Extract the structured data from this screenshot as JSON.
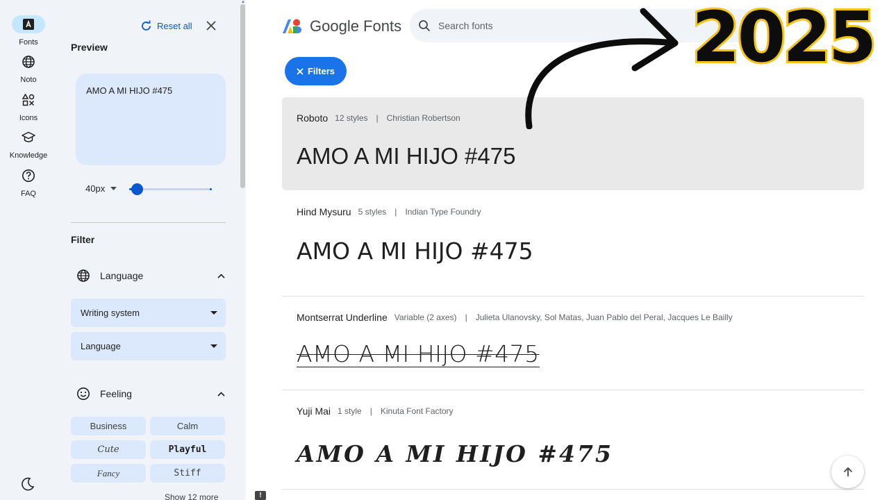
{
  "rail": {
    "items": [
      {
        "label": "Fonts",
        "icon": "font-icon",
        "active": true
      },
      {
        "label": "Noto",
        "icon": "globe-icon"
      },
      {
        "label": "Icons",
        "icon": "shapes-icon"
      },
      {
        "label": "Knowledge",
        "icon": "school-icon"
      },
      {
        "label": "FAQ",
        "icon": "help-icon"
      }
    ],
    "dark_mode_icon": "moon-icon"
  },
  "panel": {
    "reset_label": "Reset all",
    "preview_title": "Preview",
    "preview_text": "AMO A MI HIJO #475",
    "size_value": "40px",
    "size_fraction": 0.1,
    "filter_title": "Filter",
    "language_section": "Language",
    "writing_system_label": "Writing system",
    "language_dropdown_label": "Language",
    "feeling_section": "Feeling",
    "feeling_chips": [
      "Business",
      "Calm",
      "Cute",
      "Playful",
      "Fancy",
      "Stiff"
    ],
    "show_more": "Show 12 more"
  },
  "header": {
    "logo_text": "Google Fonts",
    "search_placeholder": "Search fonts",
    "filters_button": "Filters"
  },
  "fonts": [
    {
      "name": "Roboto",
      "styles": "12 styles",
      "designer": "Christian Robertson",
      "sample": "AMO A MI HIJO #475"
    },
    {
      "name": "Hind Mysuru",
      "styles": "5 styles",
      "designer": "Indian Type Foundry",
      "sample": "AMO A MI HIJO #475"
    },
    {
      "name": "Montserrat Underline",
      "styles": "Variable (2 axes)",
      "designer": "Julieta Ulanovsky, Sol Matas, Juan Pablo del Peral, Jacques Le Bailly",
      "sample": "AMO A MI HIJO #475"
    },
    {
      "name": "Yuji Mai",
      "styles": "1 style",
      "designer": "Kinuta Font Factory",
      "sample": "AMO A MI HIJO #475"
    }
  ],
  "overlay": {
    "year": "2025",
    "year_fill": "#0d0d0d",
    "year_outline": "#f3c316"
  },
  "colors": {
    "accent": "#0b57d0",
    "filters_button": "#1a73e8",
    "panel_bg": "#f0f4f9",
    "chip_bg": "#dce8fb"
  }
}
